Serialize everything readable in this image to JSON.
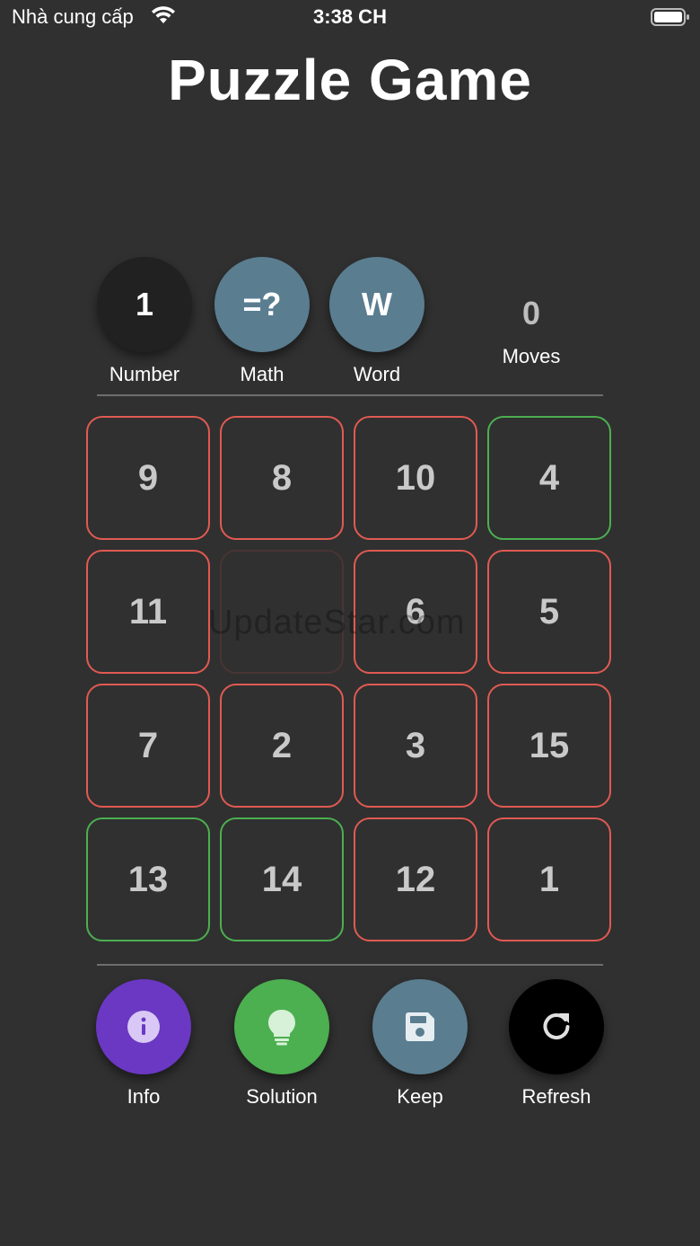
{
  "status_bar": {
    "carrier": "Nhà cung cấp",
    "time": "3:38 CH"
  },
  "title": "Puzzle Game",
  "modes": [
    {
      "symbol": "1",
      "label": "Number",
      "color": "#212121"
    },
    {
      "symbol": "=?",
      "label": "Math",
      "color": "#5a7d90"
    },
    {
      "symbol": "W",
      "label": "Word",
      "color": "#5a7d90"
    }
  ],
  "moves": {
    "count": "0",
    "label": "Moves"
  },
  "board": {
    "tiles": [
      {
        "value": "9",
        "state": "wrong"
      },
      {
        "value": "8",
        "state": "wrong"
      },
      {
        "value": "10",
        "state": "wrong"
      },
      {
        "value": "4",
        "state": "correct"
      },
      {
        "value": "11",
        "state": "wrong"
      },
      {
        "value": "",
        "state": "empty"
      },
      {
        "value": "6",
        "state": "wrong"
      },
      {
        "value": "5",
        "state": "wrong"
      },
      {
        "value": "7",
        "state": "wrong"
      },
      {
        "value": "2",
        "state": "wrong"
      },
      {
        "value": "3",
        "state": "wrong"
      },
      {
        "value": "15",
        "state": "wrong"
      },
      {
        "value": "13",
        "state": "correct"
      },
      {
        "value": "14",
        "state": "correct"
      },
      {
        "value": "12",
        "state": "wrong"
      },
      {
        "value": "1",
        "state": "wrong"
      }
    ]
  },
  "watermark": "UpdateStar.com",
  "actions": [
    {
      "label": "Info",
      "icon": "info-icon",
      "color": "#6a38c2"
    },
    {
      "label": "Solution",
      "icon": "lightbulb-icon",
      "color": "#4caf50"
    },
    {
      "label": "Keep",
      "icon": "save-icon",
      "color": "#5a7d90"
    },
    {
      "label": "Refresh",
      "icon": "refresh-icon",
      "color": "#000000"
    }
  ],
  "colors": {
    "background": "#303030",
    "tile_wrong_border": "#e05a52",
    "tile_correct_border": "#4caf50"
  }
}
